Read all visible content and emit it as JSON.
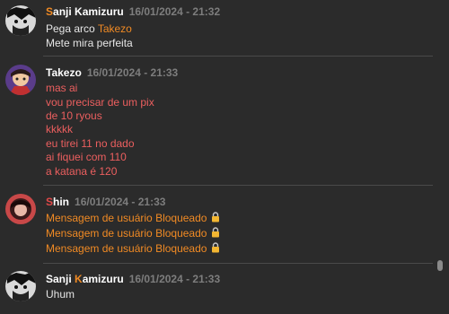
{
  "messages": [
    {
      "author_initial": "S",
      "author_rest": "anji Kamizuru",
      "timestamp": "16/01/2024 - 21:32",
      "lines_pre": "Pega arco ",
      "mention": "Takezo",
      "line2": "Mete mira perfeita"
    },
    {
      "author_initial": "T",
      "author_rest": "akezo",
      "timestamp": "16/01/2024 - 21:33",
      "lines": [
        "mas ai",
        "vou precisar de um pix",
        "de 10 ryous",
        "kkkkk",
        "eu tirei 11 no dado",
        "ai fiquei com 110",
        "a katana é 120"
      ]
    },
    {
      "author_initial": "S",
      "author_rest": "hin",
      "timestamp": "16/01/2024 - 21:33",
      "lines": [
        "Mensagem de usuário Bloqueado",
        "Mensagem de usuário Bloqueado",
        "Mensagem de usuário Bloqueado"
      ]
    },
    {
      "author_first": "Sanji ",
      "author_initial": "K",
      "author_rest": "amizuru",
      "timestamp": "16/01/2024 - 21:33",
      "lines": [
        "Uhum"
      ]
    }
  ],
  "colors": {
    "background": "#2b2b2b",
    "accent_orange": "#f08a24",
    "red_text": "#ec5f5f",
    "timestamp": "#7d7d7d"
  },
  "icons": {
    "lock": "lock-icon"
  }
}
